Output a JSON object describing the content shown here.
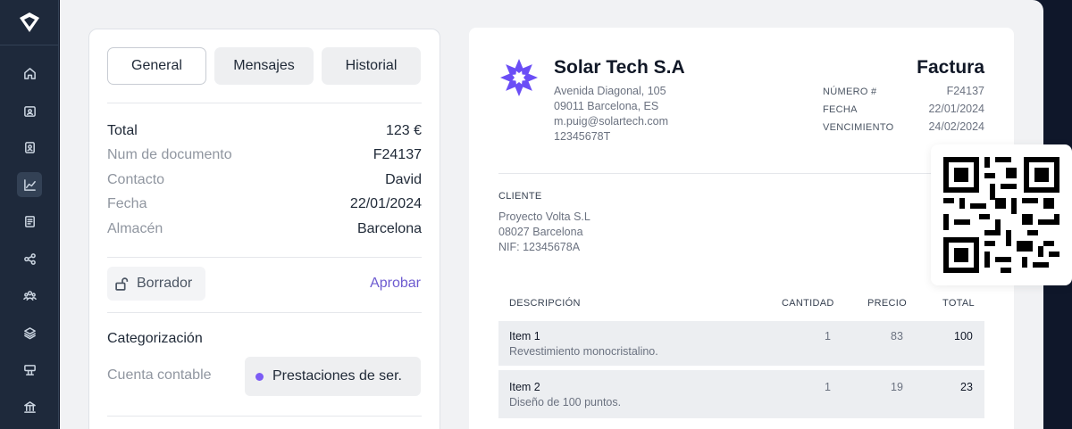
{
  "sidebar": {
    "items": [
      "home-icon",
      "contact-card-icon",
      "address-book-icon",
      "chart-icon",
      "document-icon",
      "share-icon",
      "users-icon",
      "layers-icon",
      "sign-icon",
      "bank-icon"
    ],
    "active_item": "chart-icon"
  },
  "tabs": [
    {
      "label": "General",
      "active": true
    },
    {
      "label": "Mensajes",
      "active": false
    },
    {
      "label": "Historial",
      "active": false
    }
  ],
  "details": [
    {
      "label": "Total",
      "value": "123 €"
    },
    {
      "label": "Num de documento",
      "value": "F24137"
    },
    {
      "label": "Contacto",
      "value": "David"
    },
    {
      "label": "Fecha",
      "value": "22/01/2024"
    },
    {
      "label": "Almacén",
      "value": "Barcelona"
    }
  ],
  "status": {
    "draft_label": "Borrador",
    "approve_label": "Aprobar"
  },
  "categorization": {
    "title": "Categorización",
    "account_label": "Cuenta contable",
    "account_value": "Prestaciones de ser."
  },
  "invoice": {
    "company": "Solar Tech S.A",
    "address": [
      "Avenida Diagonal, 105",
      "09011 Barcelona, ES",
      "m.puig@solartech.com",
      "12345678T"
    ],
    "title": "Factura",
    "meta": [
      {
        "label": "NÚMERO #",
        "value": "F24137"
      },
      {
        "label": "FECHA",
        "value": "22/01/2024"
      },
      {
        "label": "VENCIMIENTO",
        "value": "24/02/2024"
      }
    ],
    "client_label": "CLIENTE",
    "client": [
      "Proyecto Volta S.L",
      "08027 Barcelona",
      "NIF: 12345678A"
    ],
    "table_headers": {
      "description": "DESCRIPCIÓN",
      "quantity": "CANTIDAD",
      "price": "PRECIO",
      "total": "TOTAL"
    },
    "items": [
      {
        "name": "Item 1",
        "description": "Revestimiento monocristalino.",
        "quantity": "1",
        "price": "83",
        "total": "100"
      },
      {
        "name": "Item 2",
        "description": "Diseño de 100 puntos.",
        "quantity": "1",
        "price": "19",
        "total": "23"
      }
    ]
  },
  "colors": {
    "accent": "#6d5bd0",
    "brand_mark": "#6b4ef6",
    "sidebar": "#1e293b"
  }
}
